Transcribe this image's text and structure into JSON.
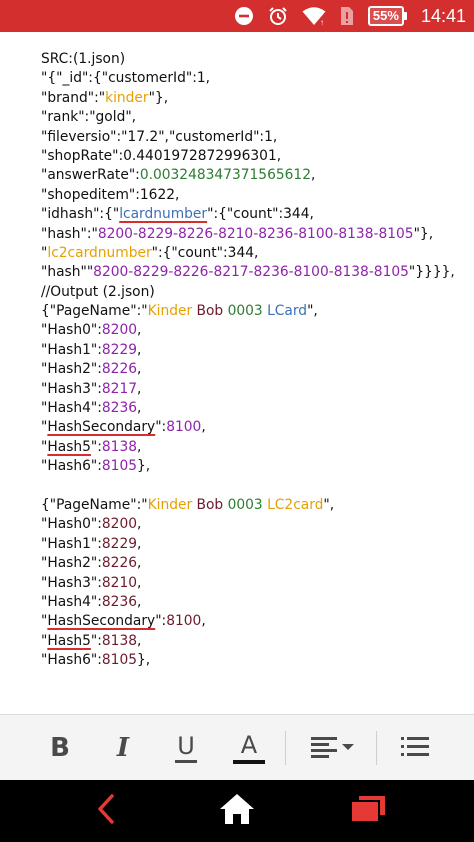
{
  "status_bar": {
    "battery": "55%",
    "time": "14:41",
    "icons": [
      "minus-circle-icon",
      "alarm-clock-icon",
      "wifi-icon",
      "sim-alert-icon",
      "battery-icon"
    ]
  },
  "document": {
    "lines": [
      [
        {
          "t": "SRC:(1.json)"
        }
      ],
      [
        {
          "t": "\"{\"_id\":{\"customerId\":1,"
        }
      ],
      [
        {
          "t": "\"brand\":\""
        },
        {
          "t": "kinder",
          "c": "o"
        },
        {
          "t": "\"},"
        }
      ],
      [
        {
          "t": "\"rank\":\"gold\","
        }
      ],
      [
        {
          "t": "\"fileversio\":\"17.2\",\"customerId\":1,"
        }
      ],
      [
        {
          "t": "\"shopRate\":0.4401972872996301,"
        }
      ],
      [
        {
          "t": "\"answerRate\":"
        },
        {
          "t": "0.003248347371565612",
          "c": "g"
        },
        {
          "t": ","
        }
      ],
      [
        {
          "t": "\"shopeditem\":1622,"
        }
      ],
      [
        {
          "t": "\"idhash\":{\""
        },
        {
          "t": "lcardnumber",
          "c": "b",
          "u": true
        },
        {
          "t": "\":{\"count\":344,"
        }
      ],
      [
        {
          "t": "\"hash\":\""
        },
        {
          "t": "8200-8229-8226-8210-8236-8100-8138-8105",
          "c": "p"
        },
        {
          "t": "\"},"
        }
      ],
      [
        {
          "t": "\""
        },
        {
          "t": "lc2cardnumber",
          "c": "o"
        },
        {
          "t": "\":{\"count\":344,"
        }
      ],
      [
        {
          "t": "\"hash\"\""
        },
        {
          "t": "8200-8229-8226-8217-8236-8100-8138-8105",
          "c": "p"
        },
        {
          "t": "\"}}}},"
        }
      ],
      [
        {
          "t": "//Output (2.json)"
        }
      ],
      [
        {
          "t": "{\"PageName\":\""
        },
        {
          "t": "Kinder",
          "c": "o"
        },
        {
          "t": " "
        },
        {
          "t": "Bob",
          "c": "m"
        },
        {
          "t": " "
        },
        {
          "t": "0003",
          "c": "g"
        },
        {
          "t": " "
        },
        {
          "t": "LCard",
          "c": "b"
        },
        {
          "t": "\","
        }
      ],
      [
        {
          "t": "\"Hash0\":"
        },
        {
          "t": "8200",
          "c": "p"
        },
        {
          "t": ","
        }
      ],
      [
        {
          "t": "\"Hash1\":"
        },
        {
          "t": "8229",
          "c": "p"
        },
        {
          "t": ","
        }
      ],
      [
        {
          "t": "\"Hash2\":"
        },
        {
          "t": "8226",
          "c": "p"
        },
        {
          "t": ","
        }
      ],
      [
        {
          "t": "\"Hash3\":"
        },
        {
          "t": "8217",
          "c": "p"
        },
        {
          "t": ","
        }
      ],
      [
        {
          "t": "\"Hash4\":"
        },
        {
          "t": "8236",
          "c": "p"
        },
        {
          "t": ","
        }
      ],
      [
        {
          "t": "\""
        },
        {
          "t": "HashSecondary",
          "u": true
        },
        {
          "t": "\":"
        },
        {
          "t": "8100",
          "c": "p"
        },
        {
          "t": ","
        }
      ],
      [
        {
          "t": "\""
        },
        {
          "t": "Hash5",
          "u": true
        },
        {
          "t": "\":"
        },
        {
          "t": "8138",
          "c": "p"
        },
        {
          "t": ","
        }
      ],
      [
        {
          "t": "\"Hash6\":"
        },
        {
          "t": "8105",
          "c": "p"
        },
        {
          "t": "},"
        }
      ],
      [],
      [
        {
          "t": "{\"PageName\":\""
        },
        {
          "t": "Kinder",
          "c": "o"
        },
        {
          "t": " "
        },
        {
          "t": "Bob",
          "c": "m"
        },
        {
          "t": " "
        },
        {
          "t": "0003",
          "c": "g"
        },
        {
          "t": " "
        },
        {
          "t": "LC2card",
          "c": "o"
        },
        {
          "t": "\","
        }
      ],
      [
        {
          "t": "\"Hash0\":"
        },
        {
          "t": "8200",
          "c": "m"
        },
        {
          "t": ","
        }
      ],
      [
        {
          "t": "\"Hash1\":"
        },
        {
          "t": "8229",
          "c": "m"
        },
        {
          "t": ","
        }
      ],
      [
        {
          "t": "\"Hash2\":"
        },
        {
          "t": "8226",
          "c": "m"
        },
        {
          "t": ","
        }
      ],
      [
        {
          "t": "\"Hash3\":"
        },
        {
          "t": "8210",
          "c": "m"
        },
        {
          "t": ","
        }
      ],
      [
        {
          "t": "\"Hash4\":"
        },
        {
          "t": "8236",
          "c": "m"
        },
        {
          "t": ","
        }
      ],
      [
        {
          "t": "\""
        },
        {
          "t": "HashSecondary",
          "u": true
        },
        {
          "t": "\":"
        },
        {
          "t": "8100",
          "c": "m"
        },
        {
          "t": ","
        }
      ],
      [
        {
          "t": "\""
        },
        {
          "t": "Hash5",
          "u": true
        },
        {
          "t": "\":"
        },
        {
          "t": "8138",
          "c": "m"
        },
        {
          "t": ","
        }
      ],
      [
        {
          "t": "\"Hash6\":"
        },
        {
          "t": "8105",
          "c": "m"
        },
        {
          "t": "},"
        }
      ]
    ]
  },
  "toolbar": {
    "bold_label": "B",
    "italic_label": "I",
    "underline_label": "U",
    "font_color_label": "A",
    "align_icon": "align-left-dropdown-icon",
    "list_icon": "bulleted-list-icon",
    "font_color_value": "#111111"
  },
  "nav_bar": {
    "back_icon": "back-chevron-icon",
    "home_icon": "home-icon",
    "recent_icon": "recent-apps-icon"
  },
  "colors": {
    "status_bar": "#d32f2f",
    "text": "#111111",
    "orange": "#e6a100",
    "green": "#2e7d32",
    "purple": "#8e24aa",
    "maroon": "#6d1b2a",
    "blue": "#3f6fb5",
    "underline": "#d32f2f",
    "nav_accent": "#e53935"
  }
}
